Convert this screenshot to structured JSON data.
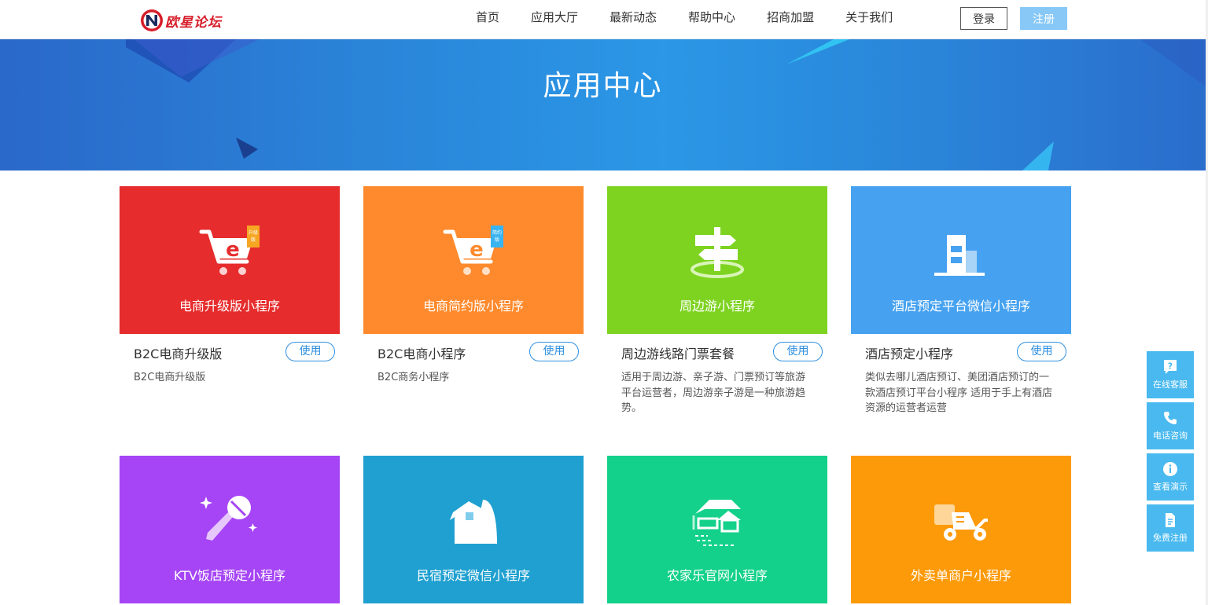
{
  "brand": {
    "logo_text": "欧星论坛"
  },
  "nav": {
    "items": [
      "首页",
      "应用大厅",
      "最新动态",
      "帮助中心",
      "招商加盟",
      "关于我们"
    ],
    "login_label": "登录",
    "register_label": "注册"
  },
  "banner": {
    "title": "应用中心"
  },
  "cards": [
    {
      "label": "电商升级版小程序",
      "name": "B2C电商升级版",
      "desc": "B2C电商升级版",
      "use": "使用",
      "color": "#e62c2c",
      "icon": "cart-upgrade-icon",
      "tag": "升级版"
    },
    {
      "label": "电商简约版小程序",
      "name": "B2C电商小程序",
      "desc": "B2C商务小程序",
      "use": "使用",
      "color": "#fe8a2d",
      "icon": "cart-simple-icon",
      "tag": "简约版"
    },
    {
      "label": "周边游小程序",
      "name": "周边游线路门票套餐",
      "desc": "适用于周边游、亲子游、门票预订等旅游平台运营者，周边游亲子游是一种旅游趋势。",
      "use": "使用",
      "color": "#7ed321",
      "icon": "signpost-icon"
    },
    {
      "label": "酒店预定平台微信小程序",
      "name": "酒店预定小程序",
      "desc": "类似去哪儿酒店预订、美团酒店预订的一款酒店预订平台小程序 适用于手上有酒店资源的运营者运营",
      "use": "使用",
      "color": "#46a2f0",
      "icon": "hotel-building-icon"
    },
    {
      "label": "KTV饭店预定小程序",
      "color": "#a645f5",
      "icon": "microphone-icon"
    },
    {
      "label": "民宿预定微信小程序",
      "color": "#1fa0d0",
      "icon": "guesthouse-icon"
    },
    {
      "label": "农家乐官网小程序",
      "color": "#13d18a",
      "icon": "farmhouse-icon"
    },
    {
      "label": "外卖单商户小程序",
      "color": "#fd9a09",
      "icon": "delivery-scooter-icon"
    }
  ],
  "side_float": [
    {
      "label": "在线客服",
      "icon": "question-chat-icon"
    },
    {
      "label": "电话咨询",
      "icon": "phone-icon"
    },
    {
      "label": "查看演示",
      "icon": "info-icon"
    },
    {
      "label": "免费注册",
      "icon": "document-icon"
    }
  ]
}
